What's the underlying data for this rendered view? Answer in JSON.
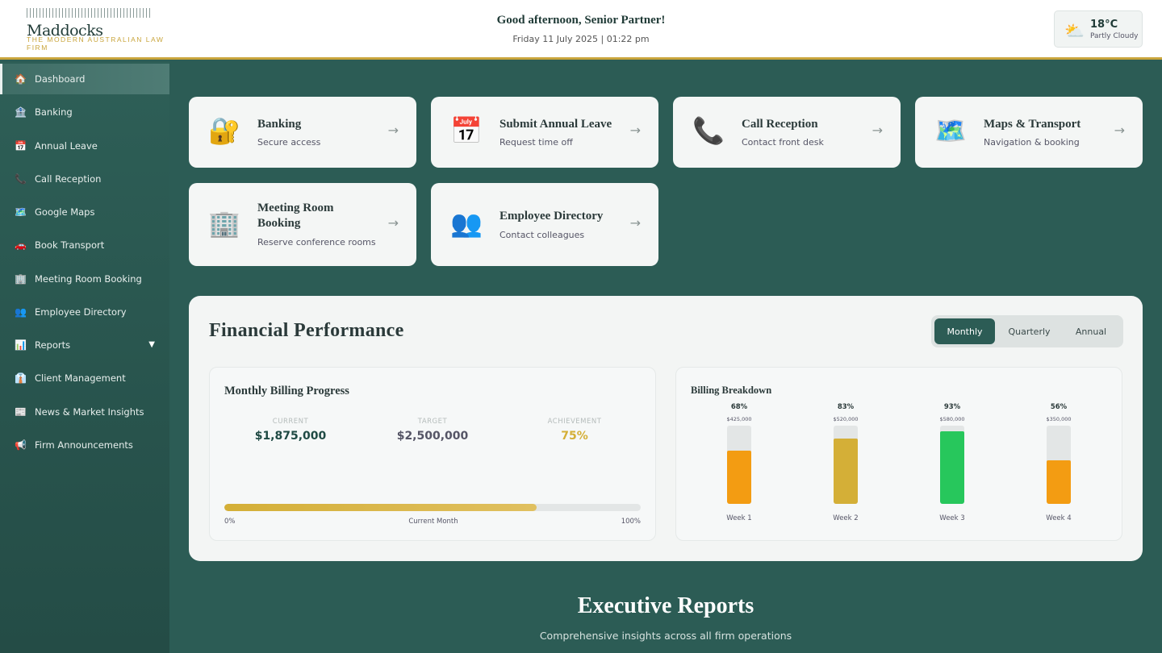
{
  "header": {
    "logo_name": "Maddocks",
    "logo_tagline": "THE MODERN AUSTRALIAN LAW FIRM",
    "greeting": "Good afternoon, Senior Partner!",
    "datetime": "Friday 11 July 2025 | 01:22 pm",
    "weather": {
      "icon": "⛅",
      "icon_name": "partly-cloudy-icon",
      "temp": "18°C",
      "condition": "Partly Cloudy"
    }
  },
  "sidebar": {
    "items": [
      {
        "label": "Dashboard",
        "icon": "🏠",
        "icon_name": "home-icon",
        "active": true
      },
      {
        "label": "Banking",
        "icon": "🏦",
        "icon_name": "bank-icon"
      },
      {
        "label": "Annual Leave",
        "icon": "📅",
        "icon_name": "calendar-icon"
      },
      {
        "label": "Call Reception",
        "icon": "📞",
        "icon_name": "phone-icon"
      },
      {
        "label": "Google Maps",
        "icon": "🗺️",
        "icon_name": "map-icon"
      },
      {
        "label": "Book Transport",
        "icon": "🚗",
        "icon_name": "car-icon"
      },
      {
        "label": "Meeting Room Booking",
        "icon": "🏢",
        "icon_name": "building-icon"
      },
      {
        "label": "Employee Directory",
        "icon": "👥",
        "icon_name": "people-icon"
      },
      {
        "label": "Reports",
        "icon": "📊",
        "icon_name": "chart-icon",
        "has_dropdown": true,
        "dropdown_glyph": "▼"
      },
      {
        "label": "Client Management",
        "icon": "👔",
        "icon_name": "tie-icon"
      },
      {
        "label": "News & Market Insights",
        "icon": "📰",
        "icon_name": "newspaper-icon"
      },
      {
        "label": "Firm Announcements",
        "icon": "📢",
        "icon_name": "megaphone-icon"
      }
    ]
  },
  "cards": [
    {
      "title": "Banking",
      "subtitle": "Secure access",
      "icon": "🔐",
      "icon_name": "lock-key-icon",
      "arrow": "→"
    },
    {
      "title": "Submit Annual Leave",
      "subtitle": "Request time off",
      "icon": "📅",
      "icon_name": "calendar-icon",
      "arrow": "→"
    },
    {
      "title": "Call Reception",
      "subtitle": "Contact front desk",
      "icon": "📞",
      "icon_name": "phone-icon",
      "arrow": "→"
    },
    {
      "title": "Maps & Transport",
      "subtitle": "Navigation & booking",
      "icon": "🗺️",
      "icon_name": "map-icon",
      "arrow": "→"
    },
    {
      "title": "Meeting Room Booking",
      "subtitle": "Reserve conference rooms",
      "icon": "🏢",
      "icon_name": "building-icon",
      "arrow": "→"
    },
    {
      "title": "Employee Directory",
      "subtitle": "Contact colleagues",
      "icon": "👥",
      "icon_name": "people-icon",
      "arrow": "→"
    }
  ],
  "financial": {
    "title": "Financial Performance",
    "periods": [
      "Monthly",
      "Quarterly",
      "Annual"
    ],
    "active_period": "Monthly",
    "billing_progress": {
      "title": "Monthly Billing Progress",
      "current_label": "CURRENT",
      "current_value": "$1,875,000",
      "target_label": "TARGET",
      "target_value": "$2,500,000",
      "achievement_label": "ACHIEVEMENT",
      "achievement_value": "75%",
      "progress_fraction": 0.75,
      "min_label": "0%",
      "mid_label": "Current Month",
      "max_label": "100%"
    },
    "breakdown_title": "Billing Breakdown"
  },
  "chart_data": {
    "type": "bar",
    "title": "Billing Breakdown",
    "categories": [
      "Week 1",
      "Week 2",
      "Week 3",
      "Week 4"
    ],
    "values": [
      68,
      83,
      93,
      56
    ],
    "percent_labels": [
      "68%",
      "83%",
      "93%",
      "56%"
    ],
    "amount_labels": [
      "$425,000",
      "$520,000",
      "$580,000",
      "$350,000"
    ],
    "bar_colors": [
      "#f39c12",
      "#d4af37",
      "#27c75c",
      "#f39c12"
    ],
    "ylim": [
      0,
      100
    ]
  },
  "executive": {
    "title": "Executive Reports",
    "subtitle": "Comprehensive insights across all firm operations"
  },
  "colors": {
    "primary": "#2c5c55",
    "gold": "#c9a53c",
    "orange": "#f39c12",
    "green": "#27c75c"
  }
}
